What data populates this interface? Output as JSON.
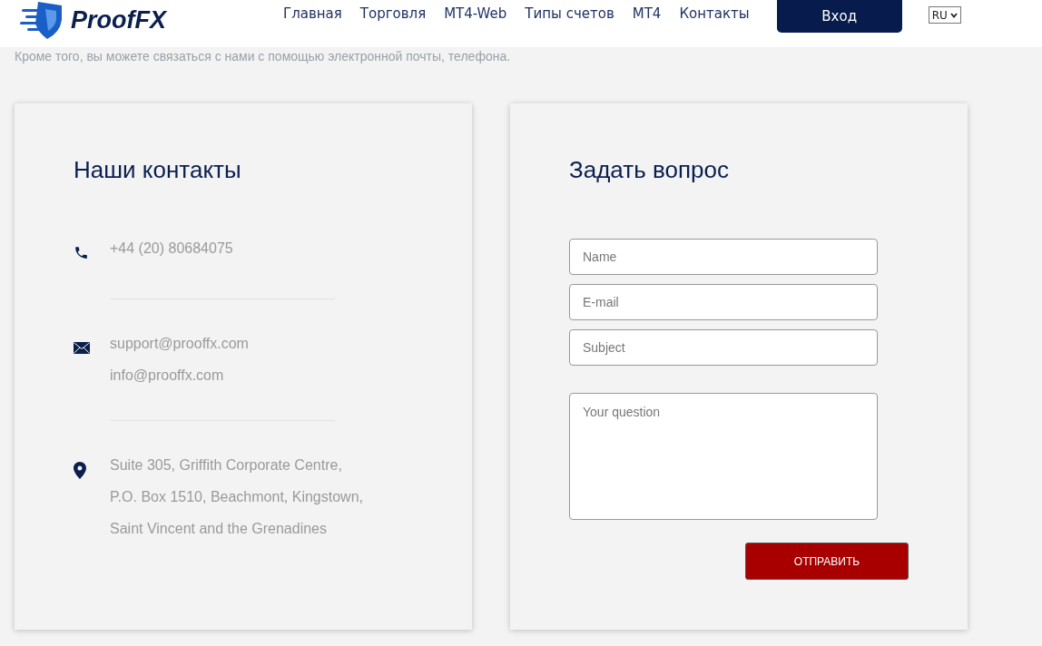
{
  "header": {
    "brand": "ProofFX",
    "nav": [
      {
        "label": "Главная"
      },
      {
        "label": "Торговля"
      },
      {
        "label": "MT4-Web"
      },
      {
        "label": "Типы счетов"
      },
      {
        "label": "MT4"
      },
      {
        "label": "Контакты"
      }
    ],
    "login": "Вход",
    "language": "RU"
  },
  "intro": "Кроме того, вы можете связаться с нами с помощью электронной почты, телефона.",
  "contacts": {
    "title": "Наши контакты",
    "groups": [
      {
        "kind": "phone",
        "lines": [
          "+44 (20) 80684075"
        ]
      },
      {
        "kind": "email",
        "lines": [
          "support@prooffx.com",
          "info@prooffx.com"
        ]
      },
      {
        "kind": "address",
        "lines": [
          "Suite 305, Griffith Corporate Centre,",
          "P.O. Box 1510, Beachmont, Kingstown,",
          "Saint Vincent and the Grenadines"
        ]
      }
    ]
  },
  "form": {
    "title": "Задать вопрос",
    "fields": [
      {
        "kind": "input",
        "placeholder": "Name"
      },
      {
        "kind": "input",
        "placeholder": "E-mail"
      },
      {
        "kind": "input",
        "placeholder": "Subject"
      },
      {
        "kind": "textarea",
        "placeholder": "Your question"
      }
    ],
    "submit": "ОТПРАВИТЬ"
  }
}
